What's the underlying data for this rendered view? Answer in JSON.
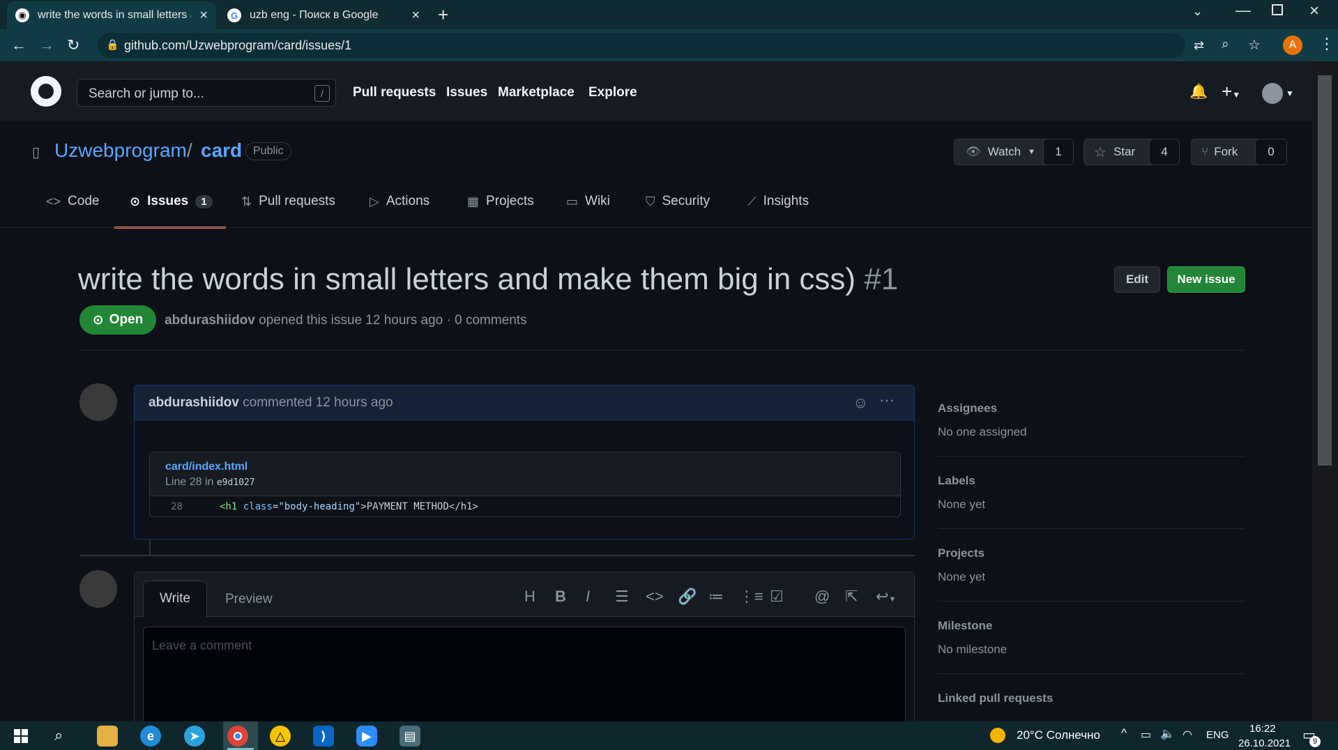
{
  "browser": {
    "tabs": [
      {
        "title": "write the words in small letters ar",
        "icon": "github-icon"
      },
      {
        "title": "uzb eng - Поиск в Google",
        "icon": "google-icon"
      }
    ],
    "url": "github.com/Uzwebprogram/card/issues/1",
    "profile_initial": "A"
  },
  "github": {
    "search_placeholder": "Search or jump to...",
    "search_shortcut": "/",
    "nav": [
      "Pull requests",
      "Issues",
      "Marketplace",
      "Explore"
    ]
  },
  "repo": {
    "owner": "Uzwebprogram",
    "separator": "/",
    "name": "card",
    "visibility": "Public",
    "watch_label": "Watch",
    "watch_count": "1",
    "star_label": "Star",
    "star_count": "4",
    "fork_label": "Fork",
    "fork_count": "0",
    "tabs": [
      {
        "label": "Code"
      },
      {
        "label": "Issues",
        "count": "1"
      },
      {
        "label": "Pull requests"
      },
      {
        "label": "Actions"
      },
      {
        "label": "Projects"
      },
      {
        "label": "Wiki"
      },
      {
        "label": "Security"
      },
      {
        "label": "Insights"
      }
    ]
  },
  "issue": {
    "title": "write the words in small letters and make them big in css)",
    "number": "#1",
    "edit_label": "Edit",
    "new_issue_label": "New issue",
    "state": "Open",
    "author": "abdurashiidov",
    "meta": "opened this issue 12 hours ago · 0 comments"
  },
  "comment": {
    "author": "abdurashiidov",
    "meta": "commented 12 hours ago",
    "file_link": "card/index.html",
    "line_info": "Line 28 in",
    "commit": "e9d1027",
    "line_number": "28",
    "code_open_tag": "<h1",
    "code_attr": "class",
    "code_eq": "=",
    "code_value": "\"body-heading\"",
    "code_text": ">PAYMENT METHOD</h1>"
  },
  "editor": {
    "write_tab": "Write",
    "preview_tab": "Preview",
    "placeholder": "Leave a comment"
  },
  "sidebar": {
    "assignees_label": "Assignees",
    "assignees_value": "No one assigned",
    "labels_label": "Labels",
    "labels_value": "None yet",
    "projects_label": "Projects",
    "projects_value": "None yet",
    "milestone_label": "Milestone",
    "milestone_value": "No milestone",
    "linked_label": "Linked pull requests"
  },
  "taskbar": {
    "weather": "20°C Солнечно",
    "language": "ENG",
    "time": "16:22",
    "date": "26.10.2021",
    "notifications": "9"
  },
  "colors": {
    "accent_blue": "#58a6ff",
    "green": "#238636",
    "issue_underline": "#f78166"
  }
}
